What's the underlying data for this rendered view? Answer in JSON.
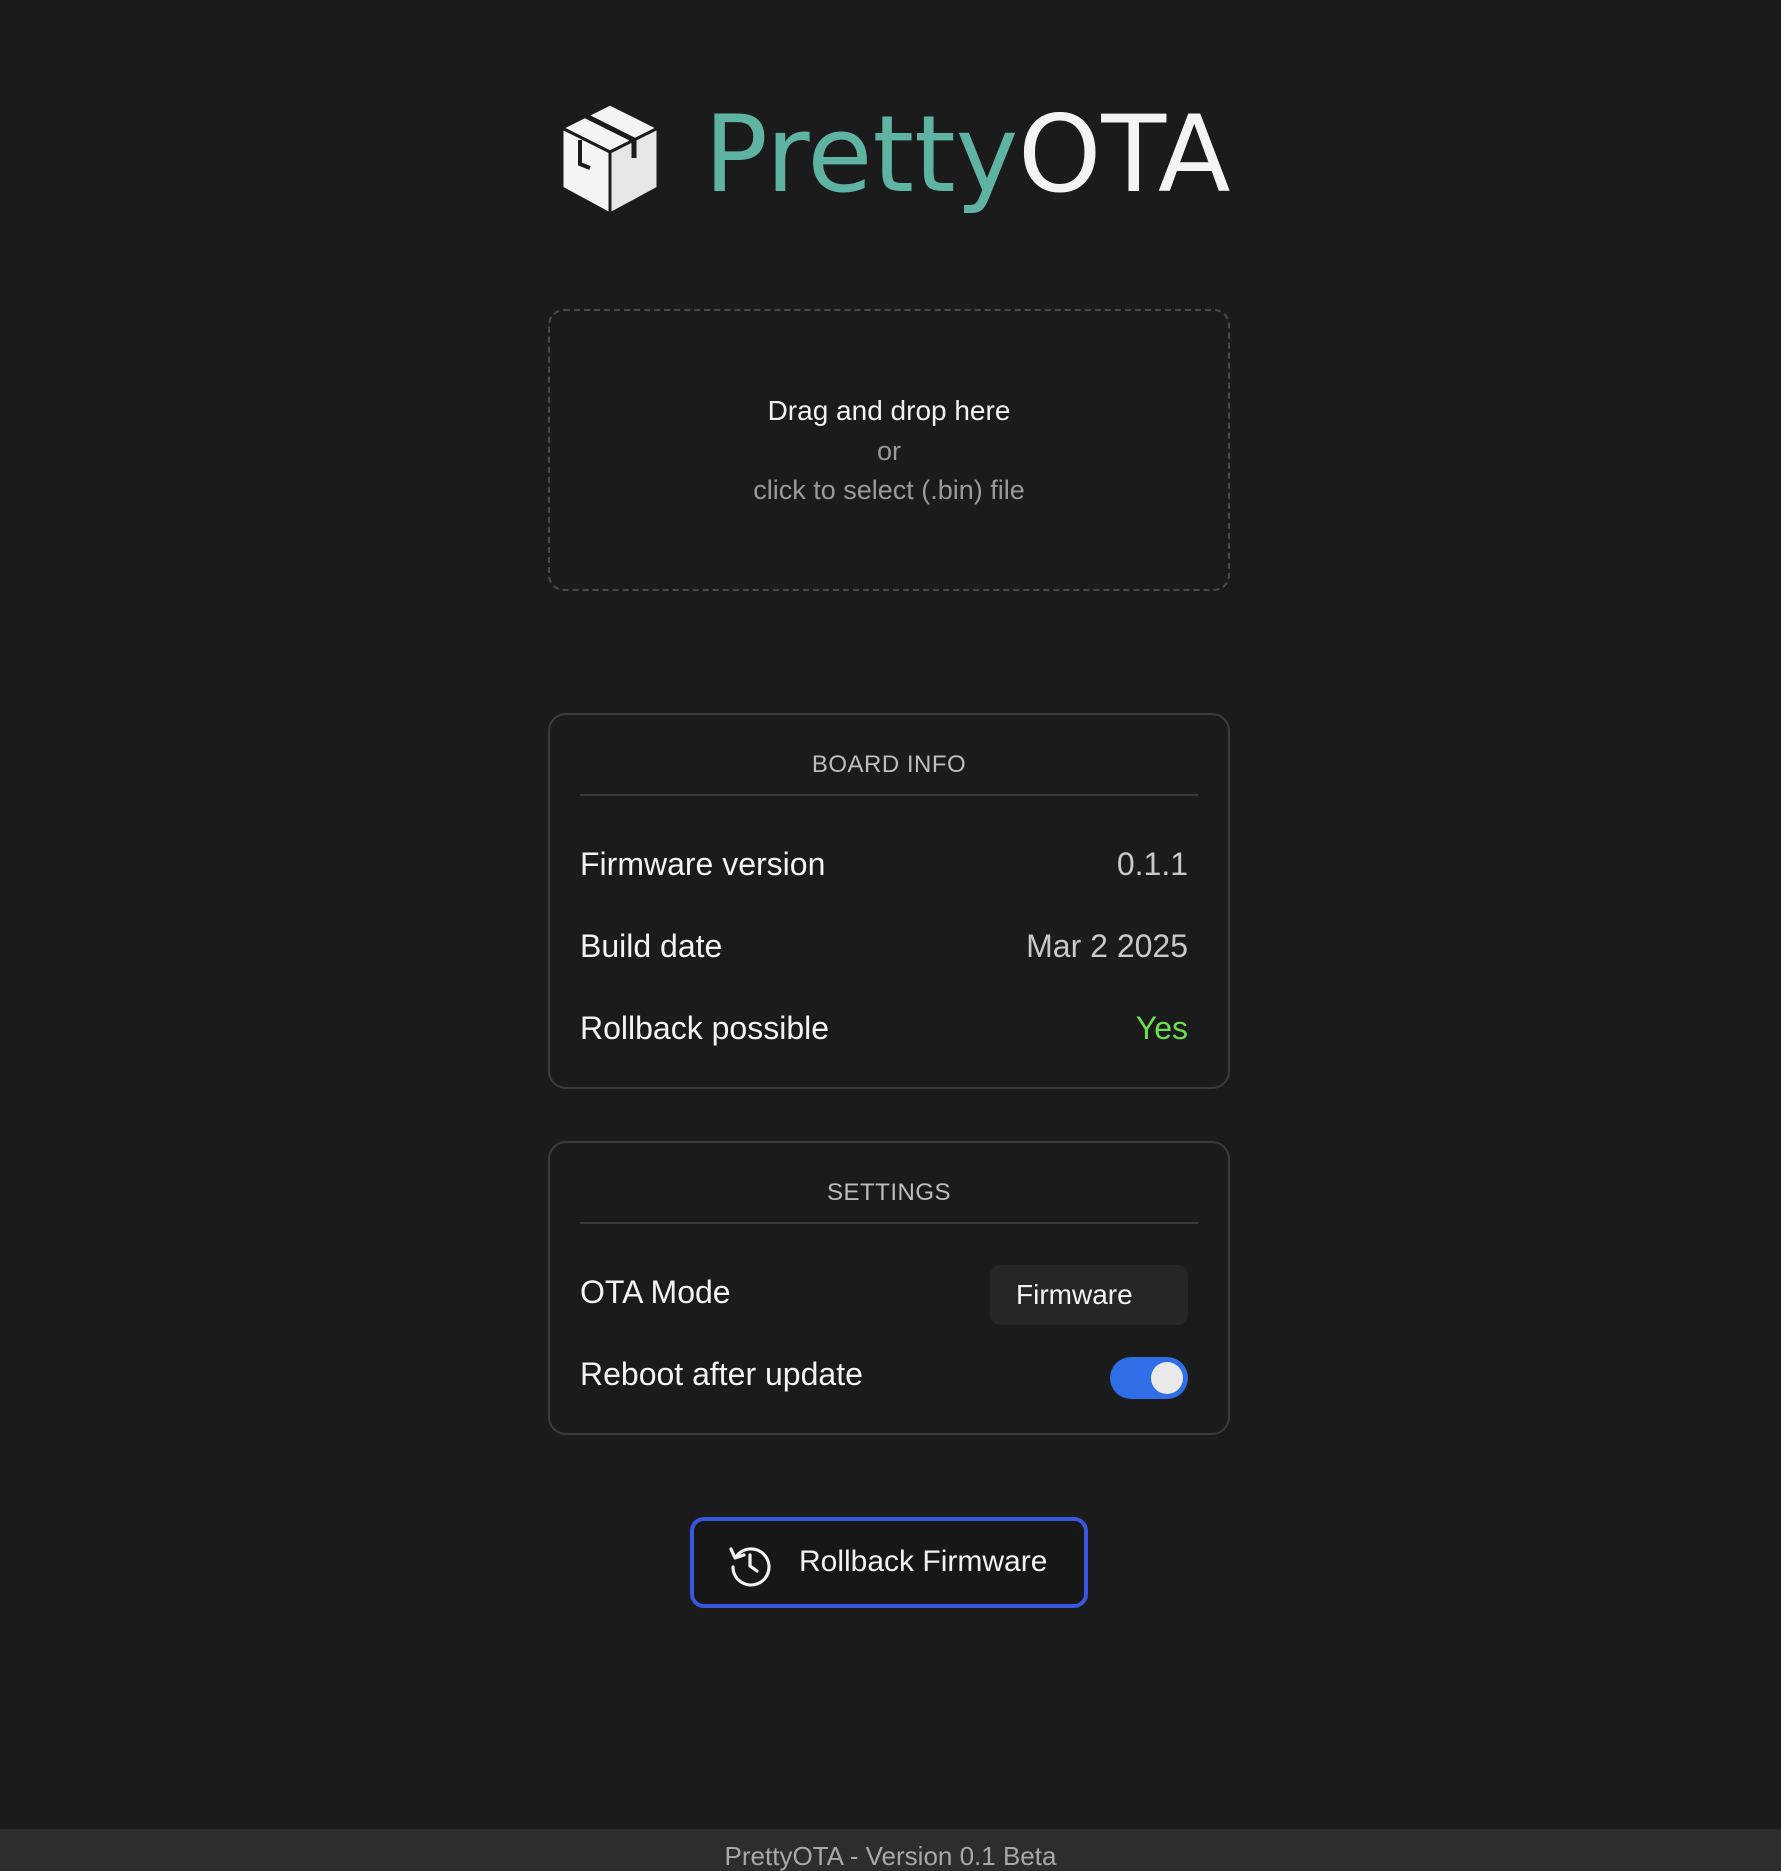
{
  "logo": {
    "text_part1": "Pretty",
    "text_part2": "OTA",
    "icon": "package-box-icon",
    "accent_color": "#5fb3a3"
  },
  "dropzone": {
    "primary": "Drag and drop here",
    "or": "or",
    "secondary": "click to select (.bin) file"
  },
  "board_info": {
    "title": "BOARD INFO",
    "rows": [
      {
        "label": "Firmware version",
        "value": "0.1.1"
      },
      {
        "label": "Build date",
        "value": "Mar 2 2025"
      },
      {
        "label": "Rollback possible",
        "value": "Yes",
        "color": "#6bdf4f"
      }
    ]
  },
  "settings": {
    "title": "SETTINGS",
    "ota_mode": {
      "label": "OTA Mode",
      "value": "Firmware"
    },
    "reboot": {
      "label": "Reboot after update",
      "enabled": true,
      "color": "#2f6ee6"
    }
  },
  "rollback_button": {
    "label": "Rollback Firmware",
    "icon": "history-icon",
    "border_color": "#3856e0"
  },
  "footer": {
    "text": "PrettyOTA - Version 0.1 Beta"
  }
}
